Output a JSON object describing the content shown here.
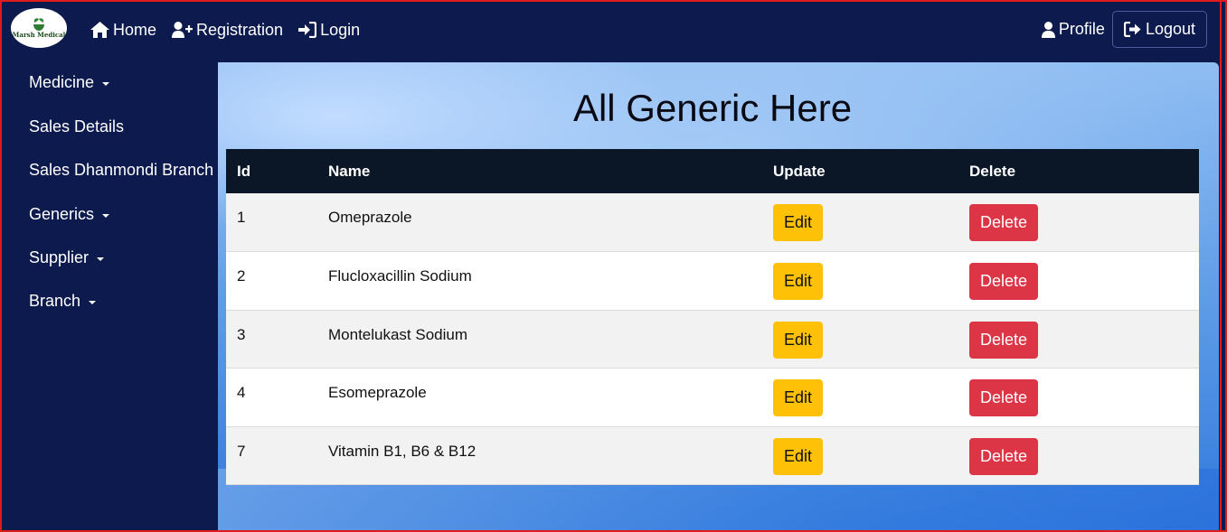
{
  "navbar": {
    "logo_text": "Marsh Medical",
    "links": [
      {
        "label": "Home",
        "icon": "home-icon"
      },
      {
        "label": "Registration",
        "icon": "user-plus-icon"
      },
      {
        "label": "Login",
        "icon": "sign-in-icon"
      }
    ],
    "profile_label": "Profile",
    "logout_label": "Logout"
  },
  "sidebar": {
    "items": [
      {
        "label": "Medicine",
        "has_dropdown": true
      },
      {
        "label": "Sales Details",
        "has_dropdown": false
      },
      {
        "label": "Sales Dhanmondi Branch",
        "has_dropdown": false
      },
      {
        "label": "Generics",
        "has_dropdown": true
      },
      {
        "label": "Supplier",
        "has_dropdown": true
      },
      {
        "label": "Branch",
        "has_dropdown": true
      }
    ]
  },
  "main": {
    "title": "All Generic Here",
    "table": {
      "headers": [
        "Id",
        "Name",
        "Update",
        "Delete"
      ],
      "rows": [
        {
          "id": "1",
          "name": "Omeprazole",
          "edit_label": "Edit",
          "delete_label": "Delete"
        },
        {
          "id": "2",
          "name": "Flucloxacillin Sodium",
          "edit_label": "Edit",
          "delete_label": "Delete"
        },
        {
          "id": "3",
          "name": "Montelukast Sodium",
          "edit_label": "Edit",
          "delete_label": "Delete"
        },
        {
          "id": "4",
          "name": "Esomeprazole",
          "edit_label": "Edit",
          "delete_label": "Delete"
        },
        {
          "id": "7",
          "name": "Vitamin B1, B6 & B12",
          "edit_label": "Edit",
          "delete_label": "Delete"
        }
      ]
    }
  },
  "colors": {
    "navbar_bg": "#0d1a4d",
    "table_header_bg": "#0b1727",
    "edit_button": "#ffc107",
    "delete_button": "#dc3545"
  }
}
